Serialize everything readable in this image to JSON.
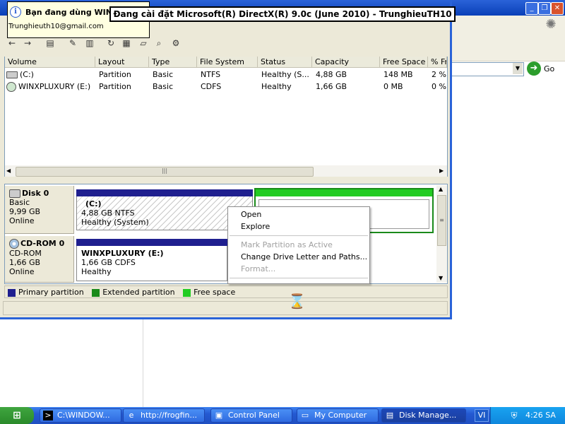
{
  "balloon": {
    "title": "Bạn đang dùng WIN",
    "email": "Trunghieuth10@gmail.com"
  },
  "dialog": {
    "title": "Đang cài đặt Microsoft(R) DirectX(R) 9.0c (June 2010) - TrunghieuTH10"
  },
  "background_window": {
    "go_label": "Go"
  },
  "volume_table": {
    "columns": [
      "Volume",
      "Layout",
      "Type",
      "File System",
      "Status",
      "Capacity",
      "Free Space",
      "% Fr"
    ],
    "rows": [
      {
        "volume": "(C:)",
        "layout": "Partition",
        "type": "Basic",
        "fs": "NTFS",
        "status": "Healthy (S...",
        "capacity": "4,88 GB",
        "free": "148 MB",
        "pct": "2 %"
      },
      {
        "volume": "WINXPLUXURY (E:)",
        "layout": "Partition",
        "type": "Basic",
        "fs": "CDFS",
        "status": "Healthy",
        "capacity": "1,66 GB",
        "free": "0 MB",
        "pct": "0 %"
      }
    ]
  },
  "disks": {
    "disk0": {
      "name": "Disk 0",
      "type": "Basic",
      "size": "9,99 GB",
      "state": "Online"
    },
    "cdrom0": {
      "name": "CD-ROM 0",
      "type": "CD-ROM",
      "size": "1,66 GB",
      "state": "Online"
    }
  },
  "partitions": {
    "c": {
      "name": "(C:)",
      "size_fs": "4,88 GB NTFS",
      "status": "Healthy (System)"
    },
    "e": {
      "name": "WINXPLUXURY  (E:)",
      "size_fs": "1,66 GB CDFS",
      "status": "Healthy"
    }
  },
  "legend": {
    "primary": "Primary partition",
    "extended": "Extended partition",
    "free": "Free space",
    "colors": {
      "primary": "#1f1f8f",
      "extended": "#1a8a1a",
      "free": "#22cc22"
    }
  },
  "context_menu": {
    "items": [
      "Open",
      "Explore",
      "Mark Partition as Active",
      "Change Drive Letter and Paths...",
      "Format..."
    ],
    "disabled": [
      "Mark Partition as Active",
      "Format..."
    ]
  },
  "taskbar": {
    "start_label": "",
    "tasks": [
      {
        "label": "C:\\WINDOW...",
        "icon": "cmd-icon"
      },
      {
        "label": "http://frogfin...",
        "icon": "ie-icon"
      },
      {
        "label": "Control Panel",
        "icon": "control-panel-icon"
      },
      {
        "label": "My Computer",
        "icon": "my-computer-icon"
      },
      {
        "label": "Disk Manage...",
        "icon": "disk-management-icon"
      }
    ],
    "language": "VI",
    "clock": "4:26 SA"
  }
}
